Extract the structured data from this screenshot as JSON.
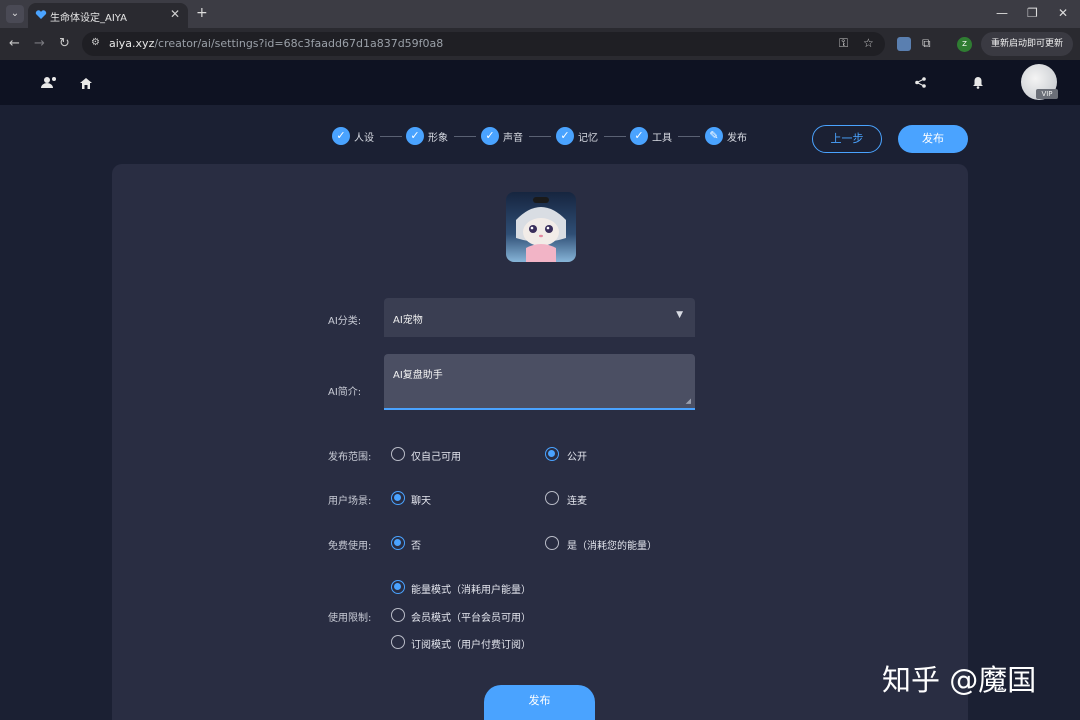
{
  "browser": {
    "tab_title": "生命体设定_AIYA",
    "tab_close": "✕",
    "new_tab": "+",
    "url_host": "aiya.xyz",
    "url_path": "/creator/ai/settings?id=68c3faadd67d1a837d59f0a8",
    "update_label": "重新启动即可更新",
    "profile_initial": "Z",
    "icons": [
      "tab-list-icon",
      "back-icon",
      "forward-icon",
      "reload-icon",
      "site-info-icon",
      "password-key-icon",
      "bookmark-star-icon",
      "extension-icon",
      "puzzle-icon",
      "minimize-icon",
      "maximize-icon",
      "close-icon"
    ]
  },
  "app": {
    "vip_label": "VIP",
    "icons": [
      "users-icon",
      "home-icon",
      "share-icon",
      "bell-icon"
    ]
  },
  "stepper": {
    "steps": [
      {
        "label": "人设",
        "state": "done"
      },
      {
        "label": "形象",
        "state": "done"
      },
      {
        "label": "声音",
        "state": "done"
      },
      {
        "label": "记忆",
        "state": "done"
      },
      {
        "label": "工具",
        "state": "done"
      },
      {
        "label": "发布",
        "state": "current"
      }
    ]
  },
  "actions": {
    "prev_label": "上一步",
    "publish_label": "发布"
  },
  "form": {
    "category_label": "AI分类:",
    "category_value": "AI宠物",
    "intro_label": "AI简介:",
    "intro_value": "AI复盘助手",
    "scope_label": "发布范围:",
    "scope_options": [
      {
        "label": "仅自己可用",
        "selected": false
      },
      {
        "label": "公开",
        "selected": true
      }
    ],
    "scene_label": "用户场景:",
    "scene_options": [
      {
        "label": "聊天",
        "selected": true
      },
      {
        "label": "连麦",
        "selected": false
      }
    ],
    "free_label": "免费使用:",
    "free_options": [
      {
        "label": "否",
        "selected": true
      },
      {
        "label": "是（消耗您的能量）",
        "selected": false
      }
    ],
    "limit_label": "使用限制:",
    "limit_options": [
      {
        "label": "能量模式（消耗用户能量）",
        "selected": true
      },
      {
        "label": "会员模式（平台会员可用）",
        "selected": false
      },
      {
        "label": "订阅模式（用户付费订阅）",
        "selected": false
      }
    ],
    "submit_label": "发布"
  },
  "watermark": "知乎 @魔国",
  "colors": {
    "accent": "#4aa3ff",
    "page_bg": "#1b2033",
    "card_bg": "#292d42",
    "appbar_bg": "#0e1222"
  }
}
